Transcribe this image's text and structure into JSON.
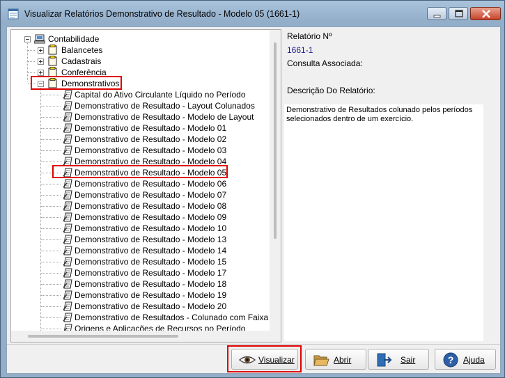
{
  "window": {
    "title": "Visualizar Relatórios Demonstrativo de Resultado - Modelo 05 (1661-1)"
  },
  "tree": {
    "root": "Contabilidade",
    "groups": [
      "Balancetes",
      "Cadastrais",
      "Conferência",
      "Demonstrativos"
    ],
    "reports": [
      "Capital do Ativo Circulante Líquido no Período",
      "Demonstrativo de Resultado - Layout Colunados",
      "Demonstrativo de Resultado - Modelo de Layout",
      "Demonstrativo de Resultado - Modelo 01",
      "Demonstrativo de Resultado - Modelo 02",
      "Demonstrativo de Resultado - Modelo 03",
      "Demonstrativo de Resultado - Modelo 04",
      "Demonstrativo de Resultado - Modelo 05",
      "Demonstrativo de Resultado - Modelo 06",
      "Demonstrativo de Resultado - Modelo 07",
      "Demonstrativo de Resultado - Modelo 08",
      "Demonstrativo de Resultado - Modelo 09",
      "Demonstrativo de Resultado - Modelo 10",
      "Demonstrativo de Resultado - Modelo 13",
      "Demonstrativo de Resultado - Modelo 14",
      "Demonstrativo de Resultado - Modelo 15",
      "Demonstrativo de Resultado - Modelo 17",
      "Demonstrativo de Resultado - Modelo 18",
      "Demonstrativo de Resultado - Modelo 19",
      "Demonstrativo de Resultado - Modelo 20",
      "Demonstrativo de Resultados - Colunado com Faixa d",
      "Origens e Aplicações de Recursos no Período"
    ]
  },
  "info": {
    "report_number_label": "Relatório Nº",
    "report_number": "1661-1",
    "consulta_label": "Consulta Associada:",
    "descricao_label": "Descrição Do Relatório:",
    "descricao_text": "Demonstrativo de Resultados colunado pelos períodos selecionados dentro de um exercício."
  },
  "buttons": {
    "visualizar": "Visualizar",
    "abrir": "Abrir",
    "sair": "Sair",
    "ajuda": "Ajuda"
  },
  "colors": {
    "highlight": "#e00000",
    "accent_text": "#1a1a8c"
  }
}
